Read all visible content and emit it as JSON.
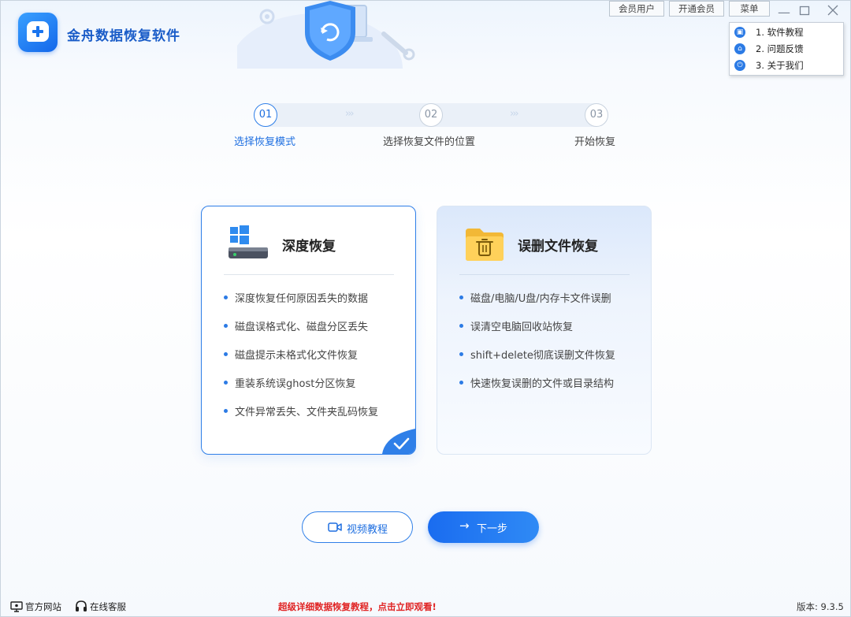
{
  "app": {
    "title": "金舟数据恢复软件"
  },
  "top_buttons": {
    "member": "会员用户",
    "open_vip": "开通会员",
    "menu": "菜单"
  },
  "menu": {
    "items": [
      {
        "label": "1. 软件教程",
        "icon": "book-icon"
      },
      {
        "label": "2. 问题反馈",
        "icon": "home-icon"
      },
      {
        "label": "3. 关于我们",
        "icon": "power-icon"
      }
    ]
  },
  "steps": [
    {
      "num": "01",
      "label": "选择恢复模式",
      "active": true
    },
    {
      "num": "02",
      "label": "选择恢复文件的位置",
      "active": false
    },
    {
      "num": "03",
      "label": "开始恢复",
      "active": false
    }
  ],
  "cards": {
    "deep": {
      "title": "深度恢复",
      "icon": "hard-drive-windows-icon",
      "bullets": [
        "深度恢复任何原因丢失的数据",
        "磁盘误格式化、磁盘分区丢失",
        "磁盘提示未格式化文件恢复",
        "重装系统误ghost分区恢复",
        "文件异常丢失、文件夹乱码恢复"
      ]
    },
    "deleted": {
      "title": "误删文件恢复",
      "icon": "folder-trash-icon",
      "bullets": [
        "磁盘/电脑/U盘/内存卡文件误删",
        "误清空电脑回收站恢复",
        "shift+delete彻底误删文件恢复",
        "快速恢复误删的文件或目录结构"
      ]
    }
  },
  "buttons": {
    "video": "视频教程",
    "next": "下一步"
  },
  "footer": {
    "website": "官方网站",
    "support": "在线客服",
    "promo": "超级详细数据恢复教程，点击立即观看!",
    "version": "版本: 9.3.5"
  },
  "colors": {
    "accent": "#2f7fe8",
    "promo": "#e02424"
  }
}
